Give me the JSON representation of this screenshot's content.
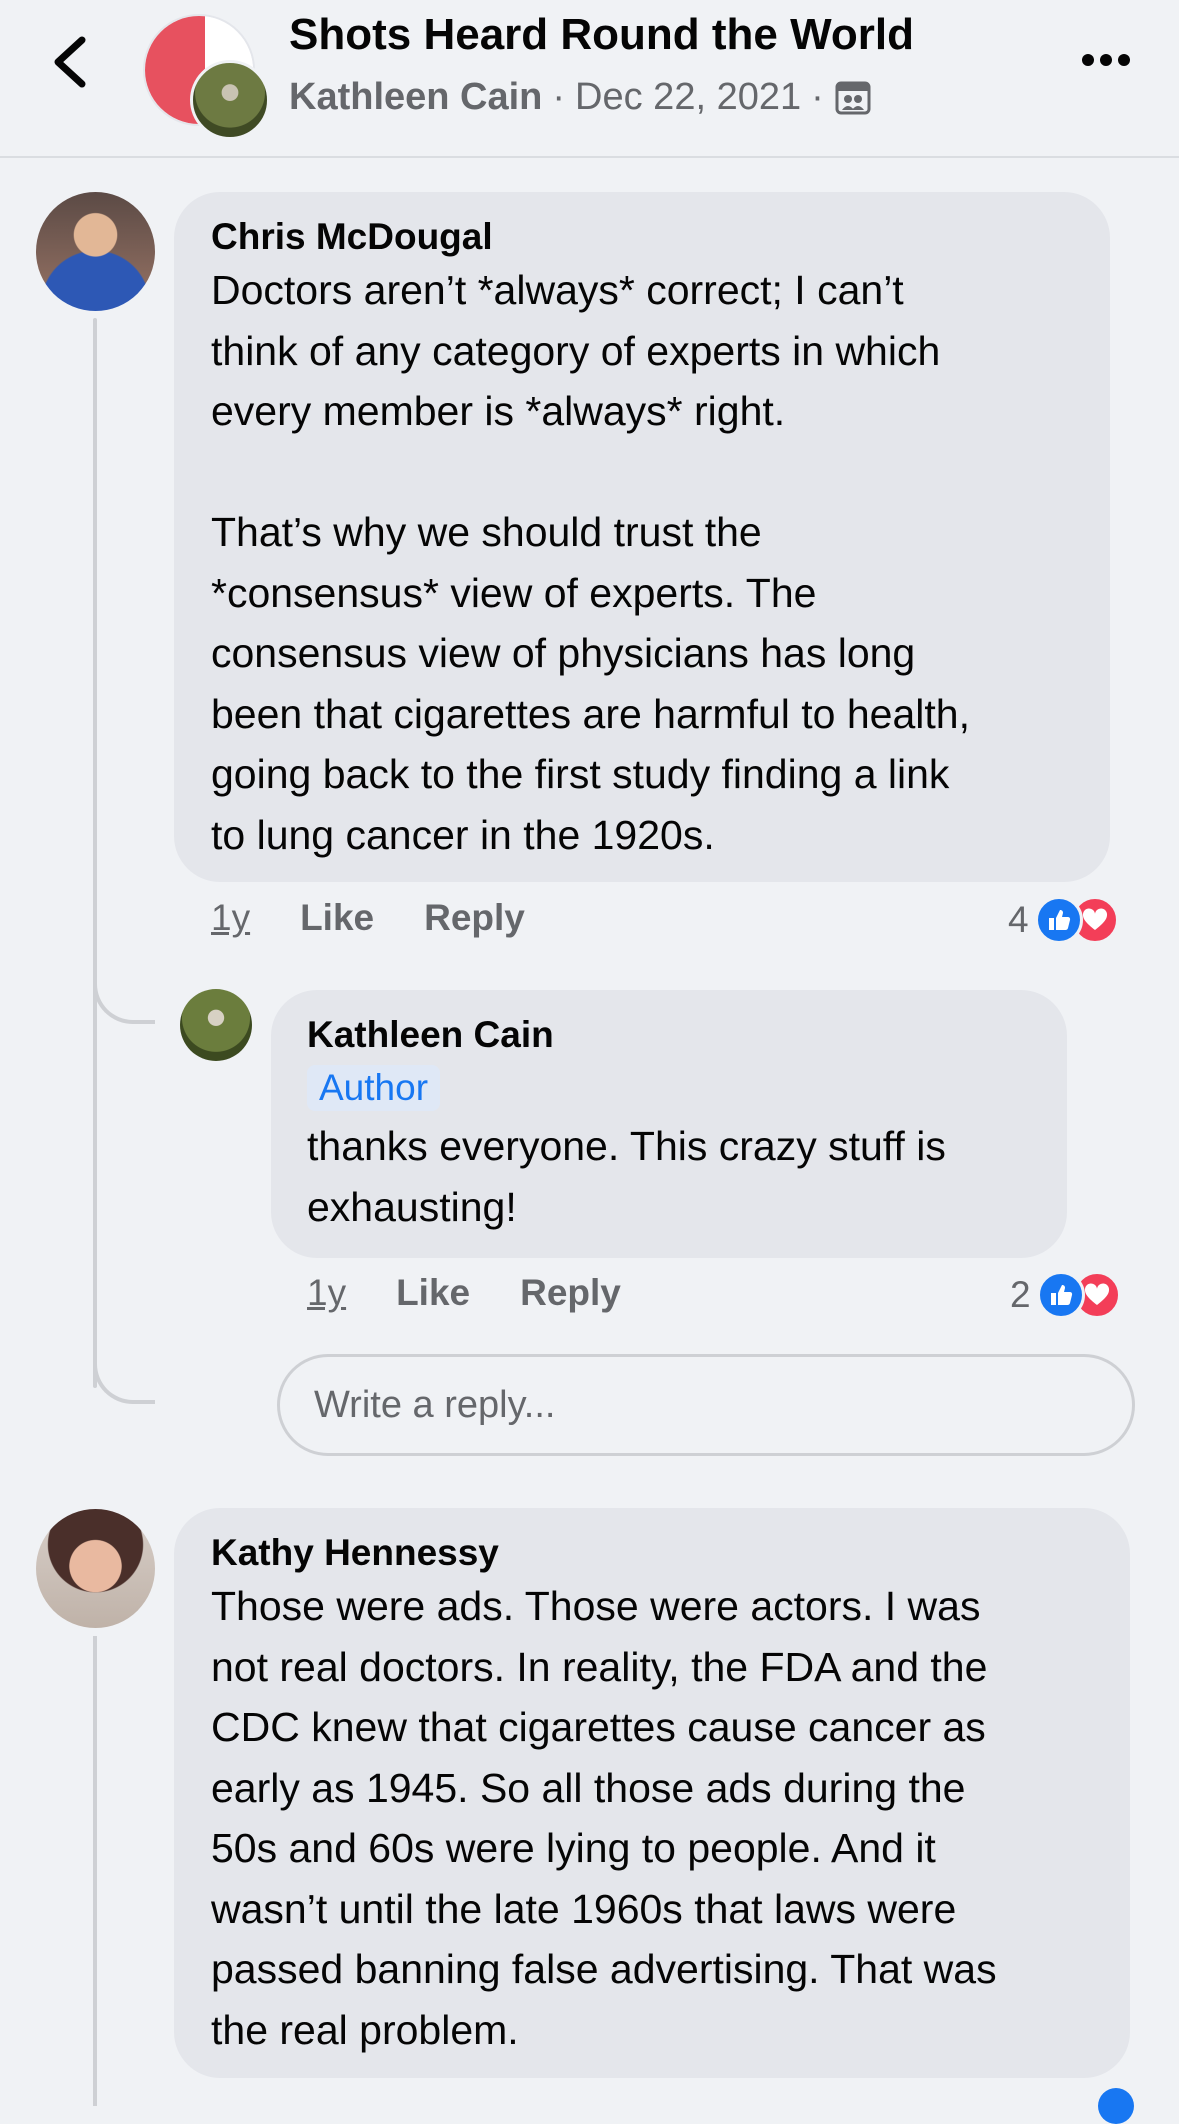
{
  "header": {
    "title": "Shots Heard Round the World",
    "author": "Kathleen Cain",
    "date": "Dec 22, 2021",
    "separator": "·",
    "privacy_icon": "group-privacy-icon",
    "back_icon": "chevron-left-icon",
    "more_icon": "more-horizontal-icon"
  },
  "comments": [
    {
      "name": "Chris McDougal",
      "text": "Doctors aren’t *always* correct; I can’t\nthink of any category of experts in which\nevery member is *always* right.\n\nThat’s why we should trust the\n*consensus* view of experts. The\nconsensus view of physicians has long\nbeen that cigarettes are harmful to health,\ngoing back to the first study finding a link\nto lung cancer in the 1920s.",
      "time": "1y",
      "like_label": "Like",
      "reply_label": "Reply",
      "reaction_count": "4"
    },
    {
      "name": "Kathleen Cain",
      "badge": "Author",
      "text": "thanks everyone. This crazy stuff is\nexhausting!",
      "time": "1y",
      "like_label": "Like",
      "reply_label": "Reply",
      "reaction_count": "2"
    },
    {
      "name": "Kathy Hennessy",
      "text": "Those were ads. Those were actors. I was\nnot real doctors. In reality, the FDA and the\nCDC knew that cigarettes cause cancer as\nearly as 1945. So all those ads during the\n50s and 60s were lying to people. And it\nwasn’t until the late 1960s that laws were\npassed banning false advertising. That was\nthe real problem."
    }
  ],
  "reply_box": {
    "placeholder": "Write a reply..."
  },
  "colors": {
    "accent": "#1877f2",
    "love": "#f33e58",
    "bubble": "#e4e6eb",
    "background": "#f0f2f5"
  }
}
